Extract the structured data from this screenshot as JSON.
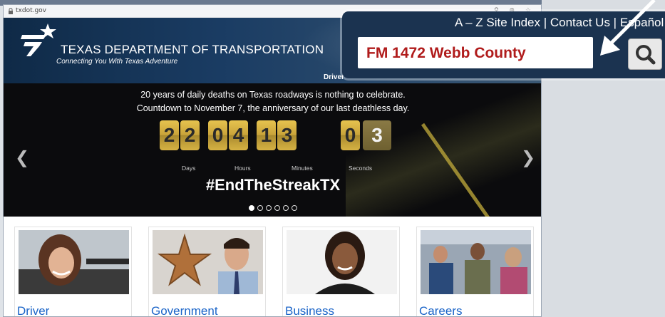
{
  "browser": {
    "url": "txdot.gov",
    "toolbar_icons": "⚲ ⊕ ☆"
  },
  "header": {
    "agency_name": "TEXAS DEPARTMENT OF TRANSPORTATION",
    "tagline": "Connecting You With Texas Adventure",
    "nav_driver": "Driver"
  },
  "utility": {
    "links": "A – Z Site Index | Contact Us | Español",
    "search_value": "FM 1472 Webb County",
    "search_icon": "magnifier-icon"
  },
  "banner": {
    "line1": "20 years of daily deaths on Texas roadways is nothing to celebrate.",
    "line2": "Countdown to November 7, the anniversary of our last deathless day.",
    "counter": {
      "days": [
        "2",
        "2"
      ],
      "hours": [
        "0",
        "4"
      ],
      "minutes": [
        "1",
        "3"
      ],
      "seconds": [
        "0",
        "3"
      ]
    },
    "labels": {
      "days": "Days",
      "hours": "Hours",
      "minutes": "Minutes",
      "seconds": "Seconds"
    },
    "hashtag": "#EndTheStreakTX",
    "slide_count": 6,
    "active_slide": 1,
    "prev_icon": "chevron-left-icon",
    "next_icon": "chevron-right-icon"
  },
  "cards": [
    {
      "title": "Driver"
    },
    {
      "title": "Government"
    },
    {
      "title": "Business"
    },
    {
      "title": "Careers"
    }
  ]
}
